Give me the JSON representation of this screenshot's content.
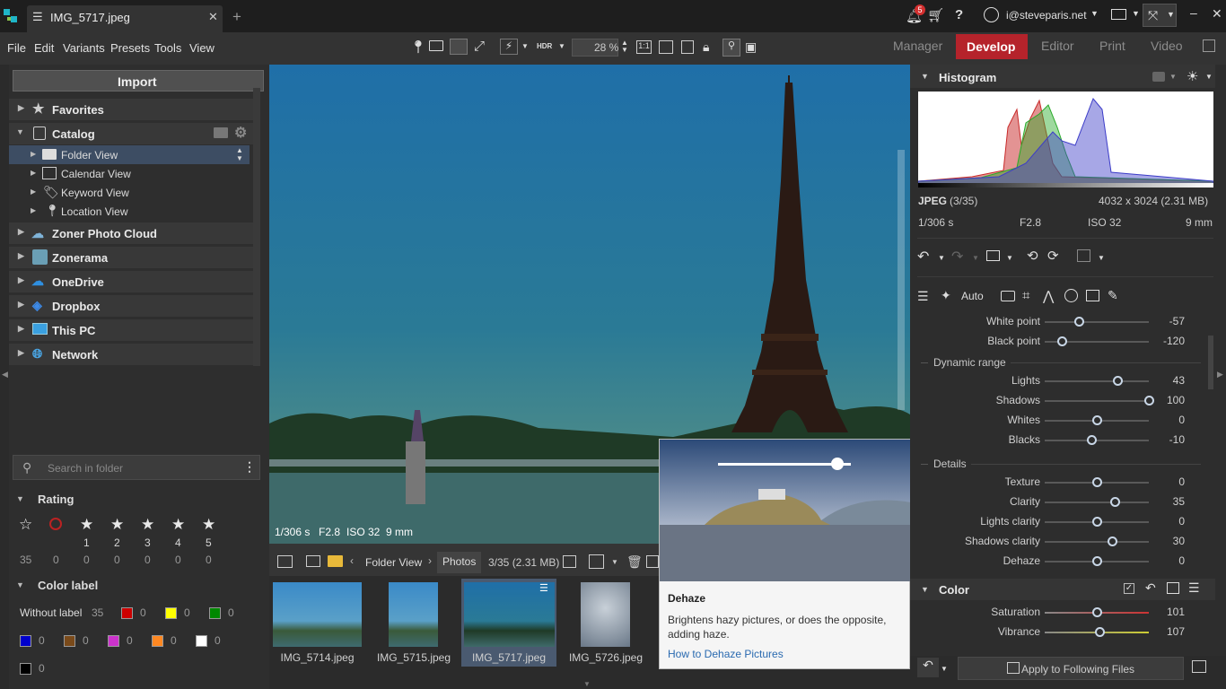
{
  "window": {
    "tab_title": "IMG_5717.jpeg",
    "notification_count": "5",
    "user": "i@steveparis.net"
  },
  "menu": [
    "File",
    "Edit",
    "Variants",
    "Presets",
    "Tools",
    "View"
  ],
  "toolbar": {
    "zoom": "28 %",
    "hdr": "HDR",
    "one_to_one": "1:1"
  },
  "modes": [
    "Manager",
    "Develop",
    "Editor",
    "Print",
    "Video"
  ],
  "active_mode": "Develop",
  "left": {
    "import": "Import",
    "nav": [
      "Favorites",
      "Catalog",
      "Zoner Photo Cloud",
      "Zonerama",
      "OneDrive",
      "Dropbox",
      "This PC",
      "Network"
    ],
    "catalog_items": [
      "Folder View",
      "Calendar View",
      "Keyword View",
      "Location View"
    ],
    "search_placeholder": "Search in folder",
    "rating_title": "Rating",
    "rating_labels": [
      "",
      "",
      "1",
      "2",
      "3",
      "4",
      "5"
    ],
    "rating_counts": [
      "35",
      "0",
      "0",
      "0",
      "0",
      "0",
      "0"
    ],
    "color_title": "Color label",
    "without_label": "Without label",
    "without_count": "35",
    "color_counts": [
      "0",
      "0",
      "0",
      "0",
      "0",
      "0",
      "0",
      "0",
      "0"
    ],
    "colors": [
      "#cc0000",
      "#ffff00",
      "#008800",
      "#0000cc",
      "#7a4a1a",
      "#cc33cc",
      "#ff8822",
      "#ffffff",
      "#000000"
    ]
  },
  "viewer": {
    "info": [
      "1/306 s",
      "F2.8",
      "ISO 32",
      "9 mm"
    ]
  },
  "filmstrip": {
    "breadcrumb": [
      "Folder View",
      "Photos"
    ],
    "count": "3/35 (2.31 MB)",
    "files": [
      "IMG_5714.jpeg",
      "IMG_5715.jpeg",
      "IMG_5717.jpeg",
      "IMG_5726.jpeg"
    ]
  },
  "tooltip": {
    "title": "Dehaze",
    "body": "Brightens hazy pictures, or does the opposite, adding haze.",
    "link": "How to Dehaze Pictures"
  },
  "right": {
    "histogram_title": "Histogram",
    "format": "JPEG",
    "index": "(3/35)",
    "dimensions": "4032 x 3024 (2.31 MB)",
    "exif": [
      "1/306 s",
      "F2.8",
      "ISO 32",
      "9 mm"
    ],
    "auto_label": "Auto",
    "sliders_top": [
      {
        "label": "White point",
        "value": "-57",
        "pos": 0.33
      },
      {
        "label": "Black point",
        "value": "-120",
        "pos": 0.16
      }
    ],
    "dynamic_range_title": "Dynamic range",
    "dynamic_range": [
      {
        "label": "Lights",
        "value": "43",
        "pos": 0.7
      },
      {
        "label": "Shadows",
        "value": "100",
        "pos": 1.0
      },
      {
        "label": "Whites",
        "value": "0",
        "pos": 0.5
      },
      {
        "label": "Blacks",
        "value": "-10",
        "pos": 0.45
      }
    ],
    "details_title": "Details",
    "details": [
      {
        "label": "Texture",
        "value": "0",
        "pos": 0.5
      },
      {
        "label": "Clarity",
        "value": "35",
        "pos": 0.67
      },
      {
        "label": "Lights clarity",
        "value": "0",
        "pos": 0.5
      },
      {
        "label": "Shadows clarity",
        "value": "30",
        "pos": 0.65
      },
      {
        "label": "Dehaze",
        "value": "0",
        "pos": 0.5
      }
    ],
    "color_title": "Color",
    "color_sliders": [
      {
        "label": "Saturation",
        "value": "101",
        "pos": 0.5
      },
      {
        "label": "Vibrance",
        "value": "107",
        "pos": 0.53
      }
    ],
    "apply_label": "Apply to Following Files"
  }
}
